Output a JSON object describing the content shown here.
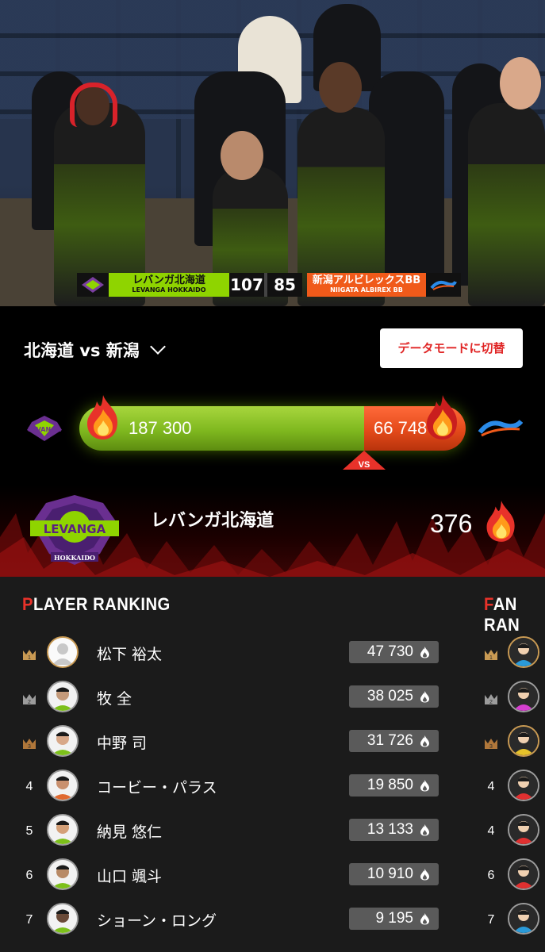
{
  "video": {
    "scoreboard": {
      "home_name_jp": "レバンガ北海道",
      "home_name_en": "LEVANGA HOKKAIDO",
      "home_score": "107",
      "away_score": "85",
      "away_name_jp": "新潟アルビレックスBB",
      "away_name_en": "NIIGATA ALBIREX BB",
      "home_color": "#8fd400",
      "away_color": "#f05a1a"
    }
  },
  "header": {
    "match_title": "北海道 vs 新潟",
    "data_mode_button": "データモードに切替"
  },
  "versus": {
    "home_points": "187 300",
    "away_points": "66 748",
    "home_share": 0.737,
    "badge": "VS"
  },
  "my_team": {
    "name": "レバンガ北海道",
    "points": "376",
    "logo_text": "LEVANGA",
    "logo_sub": "HOKKAIDO"
  },
  "player_ranking": {
    "title_first": "P",
    "title_rest": "LAYER RANKING",
    "rows": [
      {
        "rank": "1",
        "name": "松下 裕太",
        "score": "47 730"
      },
      {
        "rank": "2",
        "name": "牧 全",
        "score": "38 025"
      },
      {
        "rank": "3",
        "name": "中野 司",
        "score": "31 726"
      },
      {
        "rank": "4",
        "name": "コービー・パラス",
        "score": "19 850"
      },
      {
        "rank": "5",
        "name": "納見 悠仁",
        "score": "13 133"
      },
      {
        "rank": "6",
        "name": "山口 颯斗",
        "score": "10 910"
      },
      {
        "rank": "7",
        "name": "ショーン・ロング",
        "score": "9 195"
      }
    ]
  },
  "fan_ranking": {
    "title_first": "F",
    "title_rest": "AN RAN",
    "ranks": [
      "1",
      "2",
      "3",
      "4",
      "4",
      "6",
      "7"
    ]
  },
  "colors": {
    "accent_red": "#e8322a",
    "gold": "#c99a53",
    "silver": "#9c9c9c",
    "bronze": "#b0773a"
  }
}
